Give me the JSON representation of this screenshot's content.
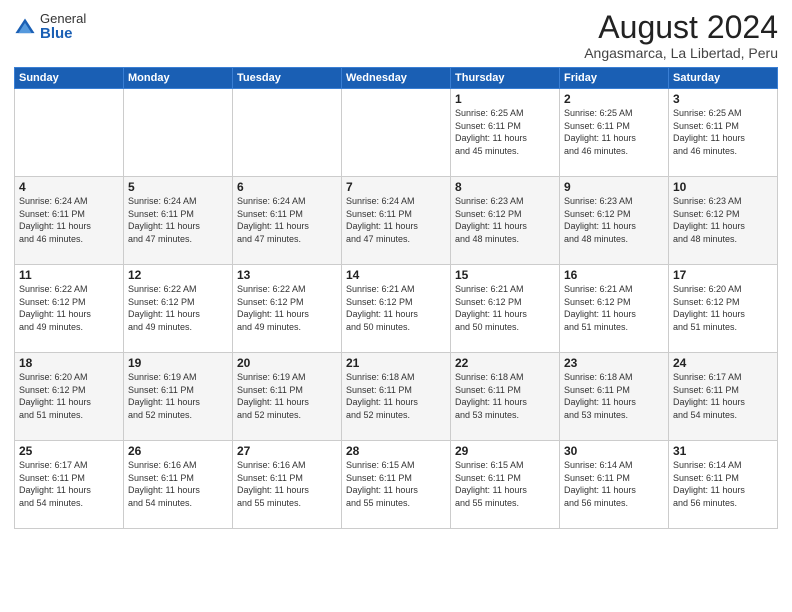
{
  "logo": {
    "general": "General",
    "blue": "Blue"
  },
  "title": "August 2024",
  "location": "Angasmarca, La Libertad, Peru",
  "days_header": [
    "Sunday",
    "Monday",
    "Tuesday",
    "Wednesday",
    "Thursday",
    "Friday",
    "Saturday"
  ],
  "weeks": [
    [
      {
        "day": "",
        "info": ""
      },
      {
        "day": "",
        "info": ""
      },
      {
        "day": "",
        "info": ""
      },
      {
        "day": "",
        "info": ""
      },
      {
        "day": "1",
        "info": "Sunrise: 6:25 AM\nSunset: 6:11 PM\nDaylight: 11 hours\nand 45 minutes."
      },
      {
        "day": "2",
        "info": "Sunrise: 6:25 AM\nSunset: 6:11 PM\nDaylight: 11 hours\nand 46 minutes."
      },
      {
        "day": "3",
        "info": "Sunrise: 6:25 AM\nSunset: 6:11 PM\nDaylight: 11 hours\nand 46 minutes."
      }
    ],
    [
      {
        "day": "4",
        "info": "Sunrise: 6:24 AM\nSunset: 6:11 PM\nDaylight: 11 hours\nand 46 minutes."
      },
      {
        "day": "5",
        "info": "Sunrise: 6:24 AM\nSunset: 6:11 PM\nDaylight: 11 hours\nand 47 minutes."
      },
      {
        "day": "6",
        "info": "Sunrise: 6:24 AM\nSunset: 6:11 PM\nDaylight: 11 hours\nand 47 minutes."
      },
      {
        "day": "7",
        "info": "Sunrise: 6:24 AM\nSunset: 6:11 PM\nDaylight: 11 hours\nand 47 minutes."
      },
      {
        "day": "8",
        "info": "Sunrise: 6:23 AM\nSunset: 6:12 PM\nDaylight: 11 hours\nand 48 minutes."
      },
      {
        "day": "9",
        "info": "Sunrise: 6:23 AM\nSunset: 6:12 PM\nDaylight: 11 hours\nand 48 minutes."
      },
      {
        "day": "10",
        "info": "Sunrise: 6:23 AM\nSunset: 6:12 PM\nDaylight: 11 hours\nand 48 minutes."
      }
    ],
    [
      {
        "day": "11",
        "info": "Sunrise: 6:22 AM\nSunset: 6:12 PM\nDaylight: 11 hours\nand 49 minutes."
      },
      {
        "day": "12",
        "info": "Sunrise: 6:22 AM\nSunset: 6:12 PM\nDaylight: 11 hours\nand 49 minutes."
      },
      {
        "day": "13",
        "info": "Sunrise: 6:22 AM\nSunset: 6:12 PM\nDaylight: 11 hours\nand 49 minutes."
      },
      {
        "day": "14",
        "info": "Sunrise: 6:21 AM\nSunset: 6:12 PM\nDaylight: 11 hours\nand 50 minutes."
      },
      {
        "day": "15",
        "info": "Sunrise: 6:21 AM\nSunset: 6:12 PM\nDaylight: 11 hours\nand 50 minutes."
      },
      {
        "day": "16",
        "info": "Sunrise: 6:21 AM\nSunset: 6:12 PM\nDaylight: 11 hours\nand 51 minutes."
      },
      {
        "day": "17",
        "info": "Sunrise: 6:20 AM\nSunset: 6:12 PM\nDaylight: 11 hours\nand 51 minutes."
      }
    ],
    [
      {
        "day": "18",
        "info": "Sunrise: 6:20 AM\nSunset: 6:12 PM\nDaylight: 11 hours\nand 51 minutes."
      },
      {
        "day": "19",
        "info": "Sunrise: 6:19 AM\nSunset: 6:11 PM\nDaylight: 11 hours\nand 52 minutes."
      },
      {
        "day": "20",
        "info": "Sunrise: 6:19 AM\nSunset: 6:11 PM\nDaylight: 11 hours\nand 52 minutes."
      },
      {
        "day": "21",
        "info": "Sunrise: 6:18 AM\nSunset: 6:11 PM\nDaylight: 11 hours\nand 52 minutes."
      },
      {
        "day": "22",
        "info": "Sunrise: 6:18 AM\nSunset: 6:11 PM\nDaylight: 11 hours\nand 53 minutes."
      },
      {
        "day": "23",
        "info": "Sunrise: 6:18 AM\nSunset: 6:11 PM\nDaylight: 11 hours\nand 53 minutes."
      },
      {
        "day": "24",
        "info": "Sunrise: 6:17 AM\nSunset: 6:11 PM\nDaylight: 11 hours\nand 54 minutes."
      }
    ],
    [
      {
        "day": "25",
        "info": "Sunrise: 6:17 AM\nSunset: 6:11 PM\nDaylight: 11 hours\nand 54 minutes."
      },
      {
        "day": "26",
        "info": "Sunrise: 6:16 AM\nSunset: 6:11 PM\nDaylight: 11 hours\nand 54 minutes."
      },
      {
        "day": "27",
        "info": "Sunrise: 6:16 AM\nSunset: 6:11 PM\nDaylight: 11 hours\nand 55 minutes."
      },
      {
        "day": "28",
        "info": "Sunrise: 6:15 AM\nSunset: 6:11 PM\nDaylight: 11 hours\nand 55 minutes."
      },
      {
        "day": "29",
        "info": "Sunrise: 6:15 AM\nSunset: 6:11 PM\nDaylight: 11 hours\nand 55 minutes."
      },
      {
        "day": "30",
        "info": "Sunrise: 6:14 AM\nSunset: 6:11 PM\nDaylight: 11 hours\nand 56 minutes."
      },
      {
        "day": "31",
        "info": "Sunrise: 6:14 AM\nSunset: 6:11 PM\nDaylight: 11 hours\nand 56 minutes."
      }
    ]
  ]
}
